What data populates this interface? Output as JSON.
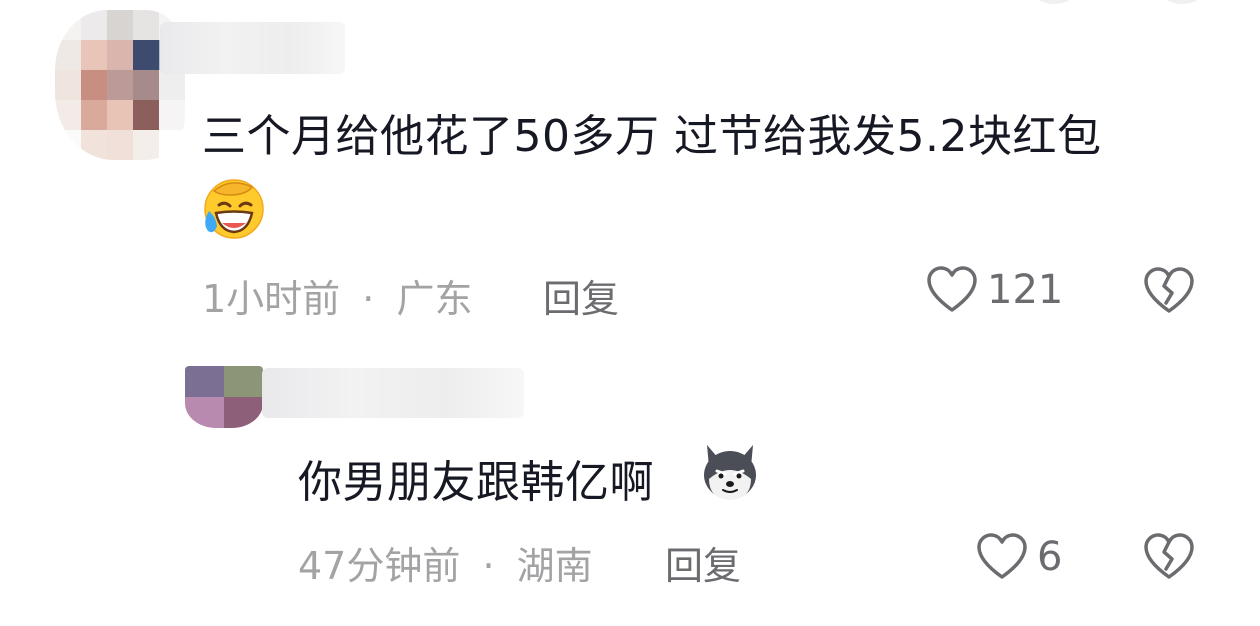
{
  "comments": [
    {
      "text": "三个月给他花了50多万 过节给我发5.2块红包",
      "emoji": "laughing-crying-emoji",
      "time": "1小时前",
      "separator": "·",
      "location": "广东",
      "reply_label": "回复",
      "likes": "121"
    },
    {
      "text": "你男朋友跟韩亿啊",
      "emoji": "husky-dog-emoji",
      "time": "47分钟前",
      "separator": "·",
      "location": "湖南",
      "reply_label": "回复",
      "likes": "6"
    }
  ],
  "icons": {
    "like": "heart-outline-icon",
    "dislike": "broken-heart-icon"
  },
  "colors": {
    "text_primary": "#161823",
    "text_meta": "#a3a3a6",
    "text_action": "#6b6b70"
  }
}
